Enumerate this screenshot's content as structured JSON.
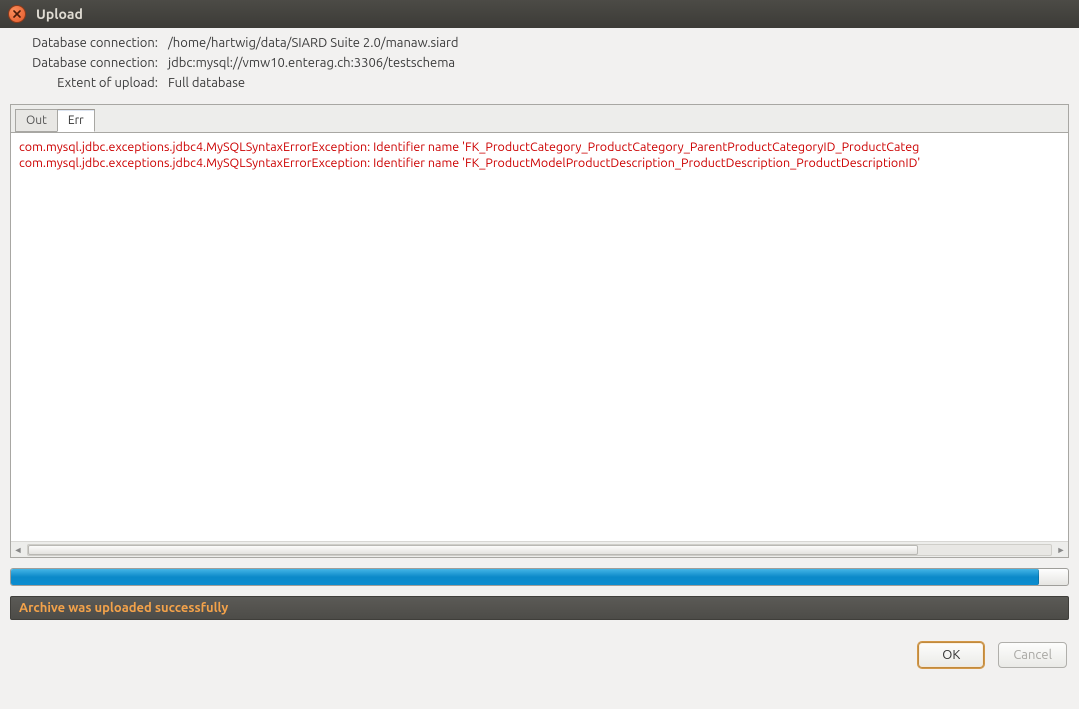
{
  "window": {
    "title": "Upload"
  },
  "info": {
    "labels": {
      "conn1": "Database connection:",
      "conn2": "Database connection:",
      "extent": "Extent of upload:"
    },
    "values": {
      "conn1": "/home/hartwig/data/SIARD Suite 2.0/manaw.siard",
      "conn2": "jdbc:mysql://vmw10.enterag.ch:3306/testschema",
      "extent": "Full database"
    }
  },
  "tabs": {
    "out": "Out",
    "err": "Err"
  },
  "log": {
    "line1": "com.mysql.jdbc.exceptions.jdbc4.MySQLSyntaxErrorException: Identifier name 'FK_ProductCategory_ProductCategory_ParentProductCategoryID_ProductCateg",
    "line2": "com.mysql.jdbc.exceptions.jdbc4.MySQLSyntaxErrorException: Identifier name 'FK_ProductModelProductDescription_ProductDescription_ProductDescriptionID'"
  },
  "status": {
    "message": "Archive was uploaded successfully"
  },
  "buttons": {
    "ok": "OK",
    "cancel": "Cancel"
  }
}
